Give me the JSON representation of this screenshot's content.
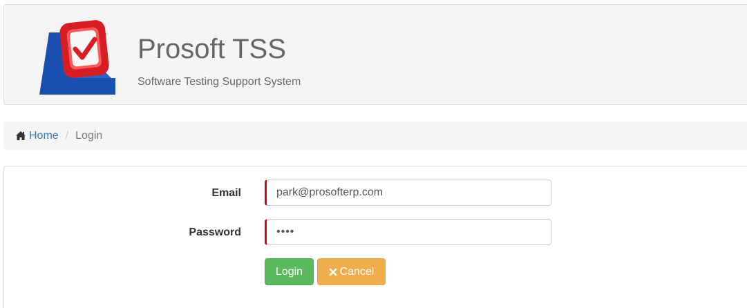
{
  "header": {
    "logo_icon": "checkmark-shield-logo-icon",
    "title": "Prosoft TSS",
    "subtitle": "Software Testing Support System"
  },
  "breadcrumb": {
    "home_icon": "home-icon",
    "home_label": "Home",
    "separator": "/",
    "current": "Login"
  },
  "form": {
    "email_label": "Email",
    "email_value": "park@prosofterp.com",
    "password_label": "Password",
    "password_value": "••••",
    "login_button": "Login",
    "cancel_icon": "times-icon",
    "cancel_button": "Cancel"
  },
  "colors": {
    "brand_red": "#e8232a",
    "brand_blue": "#1a4fb0",
    "link_blue": "#337ab7",
    "success_green": "#5cb85c",
    "warning_orange": "#f0ad4e",
    "required_red": "#d9000d"
  }
}
